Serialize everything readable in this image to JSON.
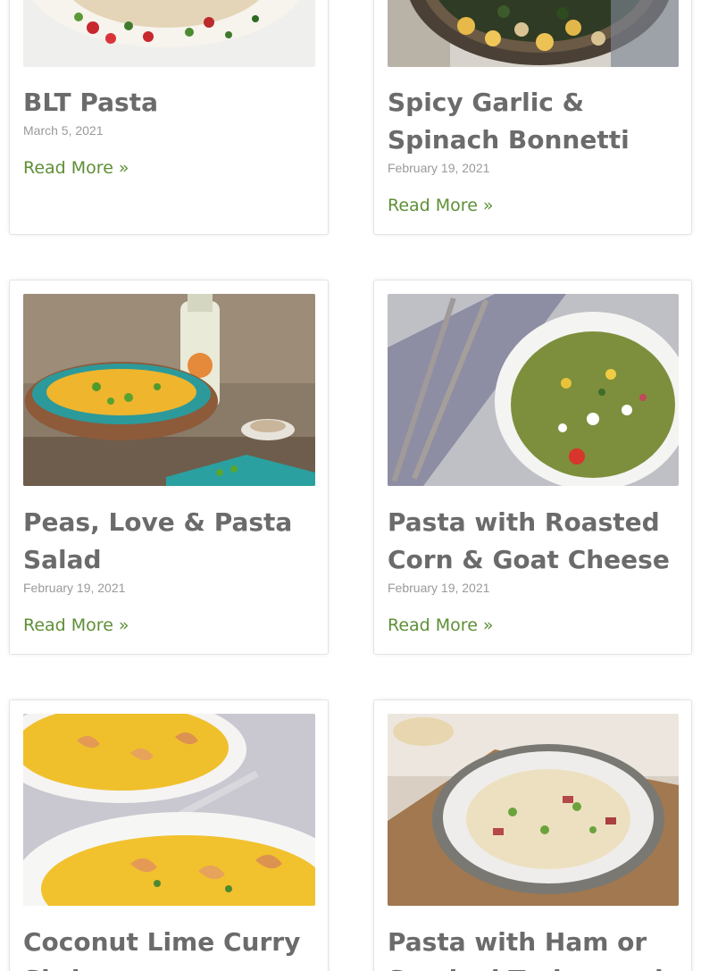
{
  "posts": [
    {
      "title": "BLT Pasta",
      "date": "March 5, 2021",
      "read_more": "Read More »"
    },
    {
      "title_line1": "Spicy Garlic &",
      "title_line2": "Spinach Bonnetti",
      "date": "February 19, 2021",
      "read_more": "Read More »"
    },
    {
      "title_line1": "Peas, Love & Pasta",
      "title_line2": "Salad",
      "date": "February 19, 2021",
      "read_more": "Read More »"
    },
    {
      "title_line1": "Pasta with Roasted",
      "title_line2": "Corn & Goat Cheese",
      "date": "February 19, 2021",
      "read_more": "Read More »"
    },
    {
      "title_line1": "Coconut Lime Curry",
      "title_line2": "Shrimp"
    },
    {
      "title_line1": "Pasta with Ham or",
      "title_line2": "Smoked Turkey and"
    }
  ],
  "colors": {
    "title": "#6b6b6b",
    "date": "#9a9a9a",
    "read_more": "#5e8f37",
    "card_border": "#e3e3e3"
  }
}
